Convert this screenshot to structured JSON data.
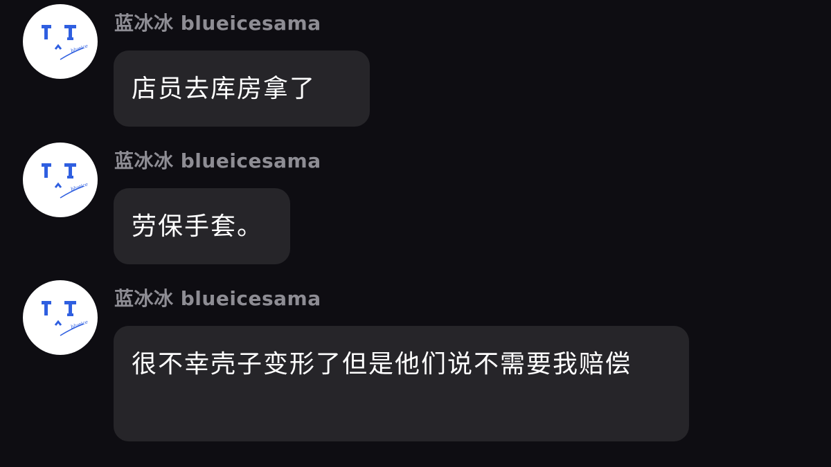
{
  "messages": [
    {
      "sender": "蓝冰冰 blueicesama",
      "text": "店员去库房拿了",
      "avatar_icon": "sad-face-avatar-icon"
    },
    {
      "sender": "蓝冰冰 blueicesama",
      "text": "劳保手套。",
      "avatar_icon": "sad-face-avatar-icon"
    },
    {
      "sender": "蓝冰冰 blueicesama",
      "text": "很不幸壳子变形了但是他们说不需要我赔偿",
      "avatar_icon": "sad-face-avatar-icon"
    }
  ],
  "avatar": {
    "signature_text": "blueice",
    "accent_color": "#2f5fe0"
  },
  "theme": {
    "background": "#0e0d12",
    "bubble": "#262529",
    "sender_color": "#8e8d94",
    "text_color": "#ffffff"
  }
}
